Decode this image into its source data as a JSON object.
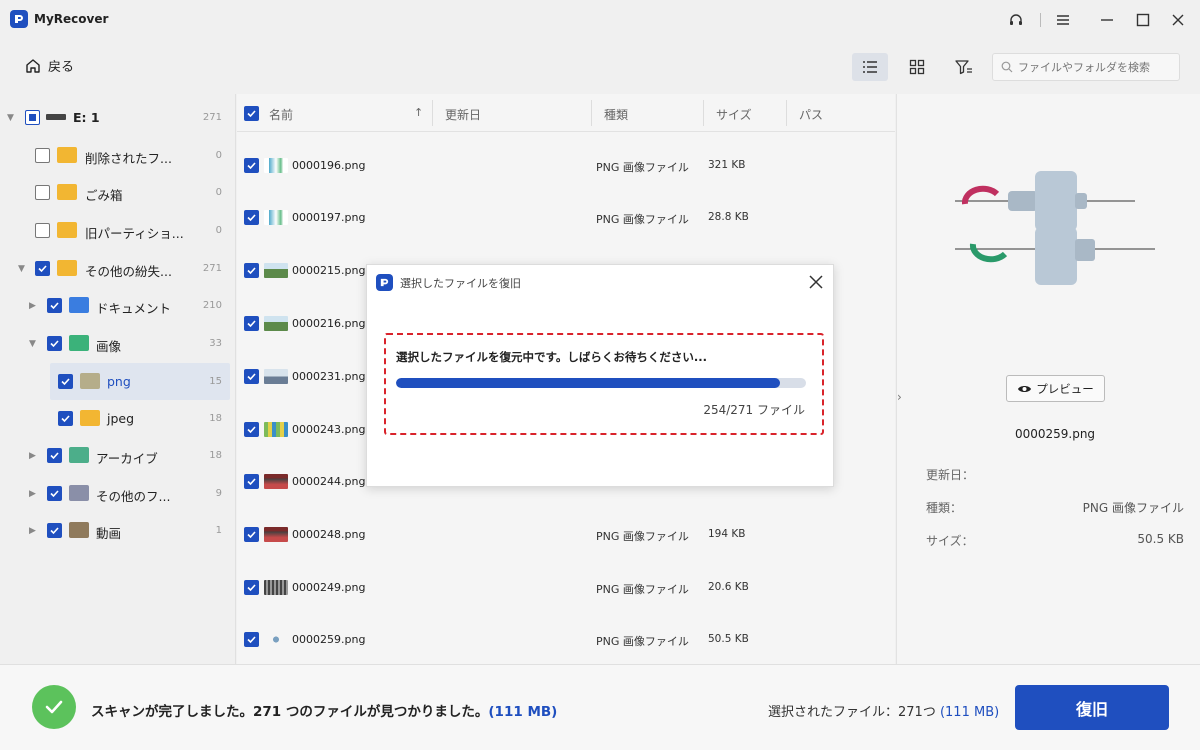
{
  "app": {
    "title": "MyRecover"
  },
  "toolbar": {
    "back_label": "戻る",
    "search_placeholder": "ファイルやフォルダを検索"
  },
  "tree": [
    {
      "label": "E: 1",
      "count": "271"
    },
    {
      "label": "削除されたフ...",
      "count": "0"
    },
    {
      "label": "ごみ箱",
      "count": "0"
    },
    {
      "label": "旧パーティショ...",
      "count": "0"
    },
    {
      "label": "その他の紛失...",
      "count": "271"
    },
    {
      "label": "ドキュメント",
      "count": "210"
    },
    {
      "label": "画像",
      "count": "33"
    },
    {
      "label": "png",
      "count": "15"
    },
    {
      "label": "jpeg",
      "count": "18"
    },
    {
      "label": "アーカイブ",
      "count": "18"
    },
    {
      "label": "その他のフ...",
      "count": "9"
    },
    {
      "label": "動画",
      "count": "1"
    }
  ],
  "columns": {
    "name": "名前",
    "modified": "更新日",
    "type": "種類",
    "size": "サイズ",
    "path": "パス"
  },
  "files": [
    {
      "name": "0000196.png",
      "type": "PNG 画像ファイル",
      "size": "321 KB"
    },
    {
      "name": "0000197.png",
      "type": "PNG 画像ファイル",
      "size": "28.8 KB"
    },
    {
      "name": "0000215.png",
      "type": "",
      "size": ""
    },
    {
      "name": "0000216.png",
      "type": "",
      "size": ""
    },
    {
      "name": "0000231.png",
      "type": "",
      "size": ""
    },
    {
      "name": "0000243.png",
      "type": "",
      "size": ""
    },
    {
      "name": "0000244.png",
      "type": "",
      "size": ""
    },
    {
      "name": "0000248.png",
      "type": "PNG 画像ファイル",
      "size": "194 KB"
    },
    {
      "name": "0000249.png",
      "type": "PNG 画像ファイル",
      "size": "20.6 KB"
    },
    {
      "name": "0000259.png",
      "type": "PNG 画像ファイル",
      "size": "50.5 KB"
    }
  ],
  "preview": {
    "button_label": "プレビュー",
    "file_name": "0000259.png",
    "meta": [
      {
        "label": "更新日：",
        "value": ""
      },
      {
        "label": "種類：",
        "value": "PNG 画像ファイル"
      },
      {
        "label": "サイズ：",
        "value": "50.5 KB"
      }
    ]
  },
  "modal": {
    "title": "選択したファイルを復旧",
    "message": "選択したファイルを復元中です。しばらくお待ちください...",
    "progress_fraction": 0.936,
    "progress_text": "254/271 ファイル"
  },
  "footer": {
    "status_main": "スキャンが完了しました。271 つのファイルが見つかりました。",
    "status_size": "(111 MB)",
    "selected_main": "選択されたファイル：271つ",
    "selected_size": "(111 MB)",
    "recover_label": "復旧"
  },
  "colors": {
    "accent": "#1f4fbf",
    "success": "#5cc25c",
    "highlight": "#d9232b"
  }
}
